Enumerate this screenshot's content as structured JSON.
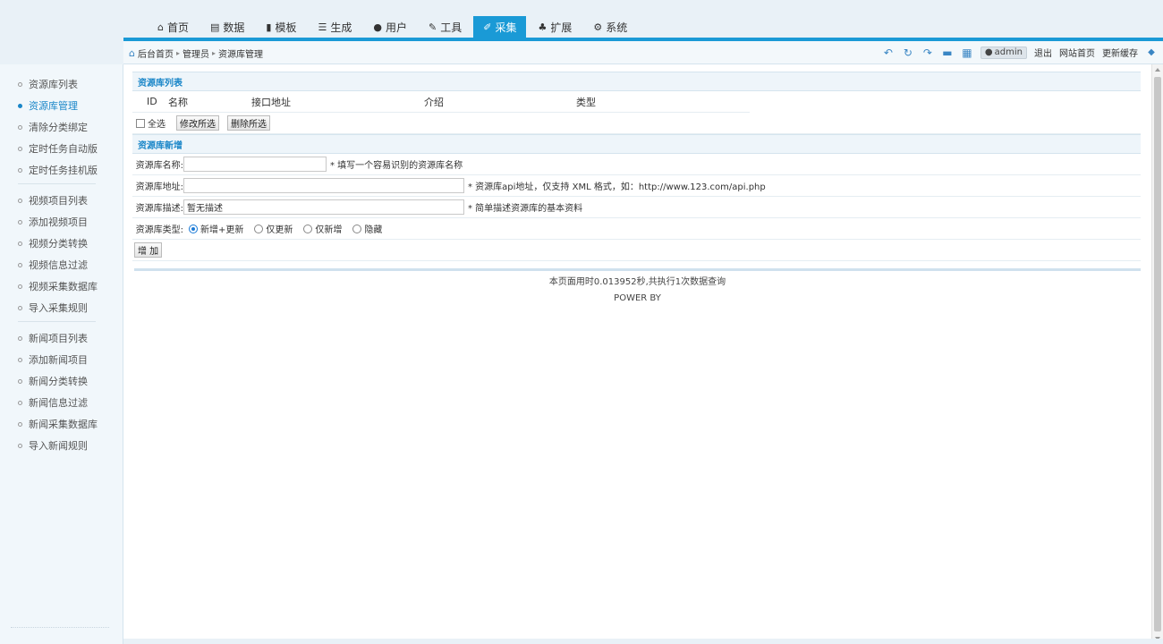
{
  "nav": {
    "tabs": [
      {
        "label": "首页",
        "icon": "home-icon",
        "glyph": "⌂"
      },
      {
        "label": "数据",
        "icon": "book-icon",
        "glyph": "▤"
      },
      {
        "label": "模板",
        "icon": "file-icon",
        "glyph": "▮"
      },
      {
        "label": "生成",
        "icon": "server-icon",
        "glyph": "☰"
      },
      {
        "label": "用户",
        "icon": "user-icon",
        "glyph": "●"
      },
      {
        "label": "工具",
        "icon": "wrench-icon",
        "glyph": "✎"
      },
      {
        "label": "采集",
        "icon": "edit-icon",
        "glyph": "✐"
      },
      {
        "label": "扩展",
        "icon": "sitemap-icon",
        "glyph": "♣"
      },
      {
        "label": "系统",
        "icon": "gear-icon",
        "glyph": "⚙"
      }
    ],
    "active_tab": "采集"
  },
  "breadcrumb": {
    "items": [
      "后台首页",
      "管理员",
      "资源库管理"
    ]
  },
  "toolbar": {
    "user": "admin",
    "logout": "退出",
    "site_home": "网站首页",
    "update_cache": "更新缓存"
  },
  "sidebar": {
    "groups": [
      [
        "资源库列表",
        "资源库管理",
        "清除分类绑定",
        "定时任务自动版",
        "定时任务挂机版"
      ],
      [
        "视频项目列表",
        "添加视频项目",
        "视频分类转换",
        "视频信息过滤",
        "视频采集数据库",
        "导入采集规则"
      ],
      [
        "新闻项目列表",
        "添加新闻项目",
        "新闻分类转换",
        "新闻信息过滤",
        "新闻采集数据库",
        "导入新闻规则"
      ]
    ],
    "active": "资源库管理"
  },
  "list_section": {
    "title": "资源库列表",
    "columns": [
      "ID",
      "名称",
      "接口地址",
      "介绍",
      "类型"
    ],
    "select_all": "全选",
    "edit_selected": "修改所选",
    "delete_selected": "删除所选"
  },
  "add_section": {
    "title": "资源库新增",
    "name_label": "资源库名称:",
    "name_value": "",
    "name_hint": "* 填写一个容易识别的资源库名称",
    "url_label": "资源库地址:",
    "url_value": "",
    "url_hint": "* 资源库api地址，仅支持 XML 格式，如：http://www.123.com/api.php",
    "desc_label": "资源库描述:",
    "desc_value": "暂无描述",
    "desc_hint": "* 简单描述资源库的基本资料",
    "type_label": "资源库类型:",
    "type_options": [
      "新增+更新",
      "仅更新",
      "仅新增",
      "隐藏"
    ],
    "type_selected": "新增+更新",
    "submit": "增 加"
  },
  "footer": {
    "timing": "本页面用时0.013952秒,共执行1次数据查询",
    "powered": "POWER BY"
  },
  "colors": {
    "accent": "#1a9ad6",
    "link": "#1a86c8"
  }
}
